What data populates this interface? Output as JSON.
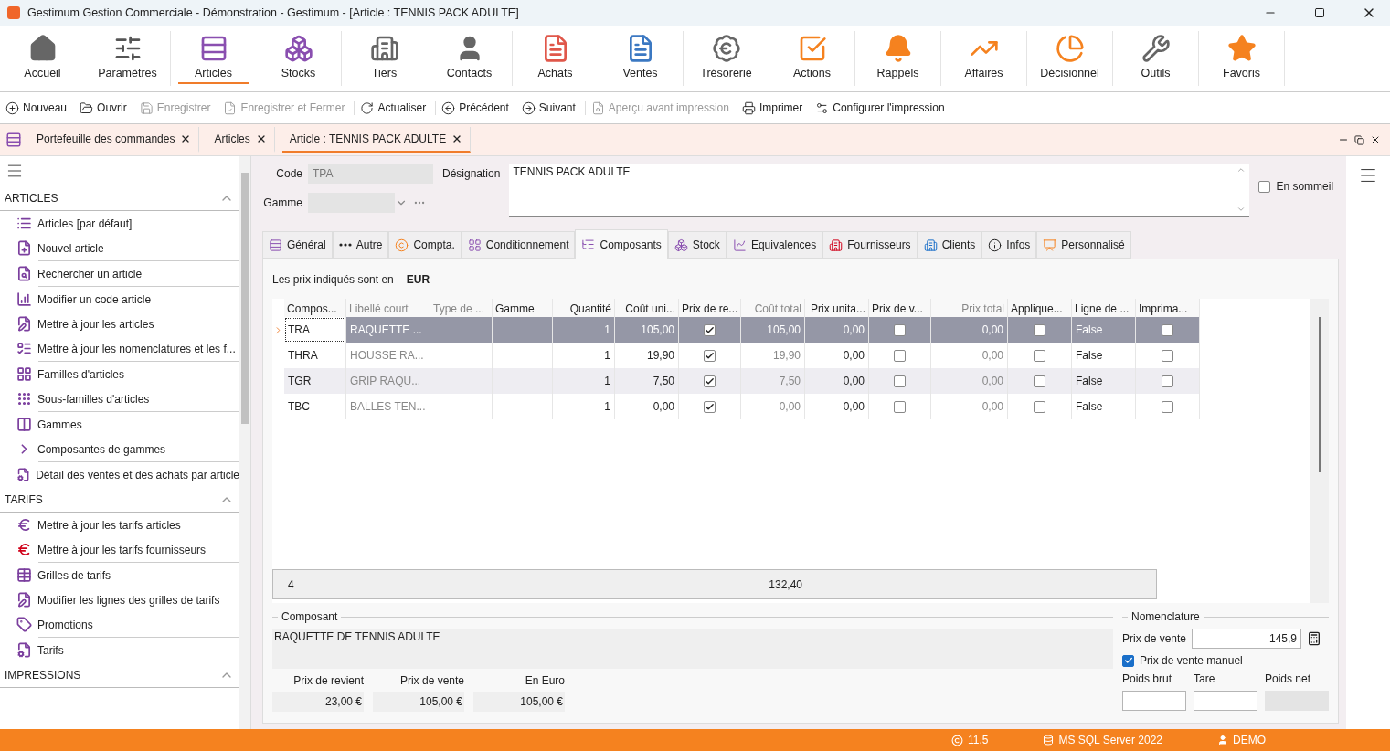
{
  "window": {
    "title": "Gestimum Gestion Commerciale - Démonstration - Gestimum - [Article : TENNIS PACK ADULTE]"
  },
  "ribbon": {
    "groups": [
      [
        {
          "label": "Accueil",
          "selected": false
        },
        {
          "label": "Paramètres",
          "selected": false
        }
      ],
      [
        {
          "label": "Articles",
          "selected": true
        },
        {
          "label": "Stocks",
          "selected": false
        }
      ],
      [
        {
          "label": "Tiers",
          "selected": false
        },
        {
          "label": "Contacts",
          "selected": false
        }
      ],
      [
        {
          "label": "Achats",
          "selected": false
        },
        {
          "label": "Ventes",
          "selected": false
        }
      ],
      [
        {
          "label": "Trésorerie",
          "selected": false
        }
      ],
      [
        {
          "label": "Actions",
          "selected": false
        }
      ],
      [
        {
          "label": "Rappels",
          "selected": false
        }
      ],
      [
        {
          "label": "Affaires",
          "selected": false
        }
      ],
      [
        {
          "label": "Décisionnel",
          "selected": false
        }
      ],
      [
        {
          "label": "Outils",
          "selected": false
        }
      ],
      [
        {
          "label": "Favoris",
          "selected": false
        }
      ]
    ]
  },
  "toolbar": {
    "groups": [
      [
        {
          "label": "Nouveau",
          "disabled": false
        },
        {
          "label": "Ouvrir",
          "disabled": false
        },
        {
          "label": "Enregistrer",
          "disabled": true
        },
        {
          "label": "Enregistrer et Fermer",
          "disabled": true
        }
      ],
      [
        {
          "label": "Actualiser",
          "disabled": false
        }
      ],
      [
        {
          "label": "Précédent",
          "disabled": false
        },
        {
          "label": "Suivant",
          "disabled": false
        }
      ],
      [
        {
          "label": "Aperçu avant impression",
          "disabled": true
        },
        {
          "label": "Imprimer",
          "disabled": false
        },
        {
          "label": "Configurer l'impression",
          "disabled": false
        }
      ]
    ]
  },
  "doc_tabs": [
    {
      "label": "Portefeuille des commandes",
      "selected": false
    },
    {
      "label": "Articles",
      "selected": false
    },
    {
      "label": "Article : TENNIS PACK ADULTE",
      "selected": true
    }
  ],
  "sidebar": {
    "sections": [
      {
        "title": "ARTICLES",
        "expanded": true,
        "groups": [
          [
            {
              "label": "Articles [par défaut]",
              "color": "#7b3f9e"
            },
            {
              "label": "Nouvel article",
              "color": "#7b3f9e"
            }
          ],
          [
            {
              "label": "Rechercher un article",
              "color": "#7b3f9e"
            }
          ],
          [
            {
              "label": "Modifier un code article",
              "color": "#7b3f9e"
            },
            {
              "label": "Mettre à jour les articles",
              "color": "#7b3f9e"
            },
            {
              "label": "Mettre à jour les nomenclatures et les f...",
              "color": "#7b3f9e"
            }
          ],
          [
            {
              "label": "Familles d'articles",
              "color": "#7b3f9e"
            },
            {
              "label": "Sous-familles d'articles",
              "color": "#7b3f9e"
            }
          ],
          [
            {
              "label": "Gammes",
              "color": "#7b3f9e"
            },
            {
              "label": "Composantes de gammes",
              "color": "#7b3f9e"
            }
          ],
          [
            {
              "label": "Détail des ventes et des achats par article",
              "color": "#7b3f9e"
            }
          ]
        ]
      },
      {
        "title": "TARIFS",
        "expanded": true,
        "groups": [
          [
            {
              "label": "Mettre à jour les tarifs articles",
              "color": "#7b3f9e"
            },
            {
              "label": "Mettre à jour les tarifs fournisseurs",
              "color": "#d0021b"
            }
          ],
          [
            {
              "label": "Grilles de tarifs",
              "color": "#7b3f9e"
            },
            {
              "label": "Modifier les lignes des grilles de tarifs",
              "color": "#7b3f9e"
            },
            {
              "label": "Promotions",
              "color": "#7b3f9e"
            }
          ],
          [
            {
              "label": "Tarifs",
              "color": "#7b3f9e"
            }
          ]
        ]
      },
      {
        "title": "IMPRESSIONS",
        "expanded": true
      }
    ]
  },
  "form": {
    "code": {
      "label": "Code",
      "value": "TPA"
    },
    "designation": {
      "label": "Désignation",
      "value": "TENNIS PACK ADULTE"
    },
    "gamme": {
      "label": "Gamme"
    },
    "sleeping": {
      "label": "En sommeil",
      "checked": false
    }
  },
  "form_tabs": [
    {
      "label": "Général",
      "selected": false
    },
    {
      "label": "Autre",
      "selected": false
    },
    {
      "label": "Compta.",
      "selected": false
    },
    {
      "label": "Conditionnement",
      "selected": false
    },
    {
      "label": "Composants",
      "selected": true
    },
    {
      "label": "Stock",
      "selected": false
    },
    {
      "label": "Equivalences",
      "selected": false
    },
    {
      "label": "Fournisseurs",
      "selected": false
    },
    {
      "label": "Clients",
      "selected": false
    },
    {
      "label": "Infos",
      "selected": false
    },
    {
      "label": "Personnalisé",
      "selected": false
    }
  ],
  "currency_note": {
    "label": "Les prix indiqués sont en",
    "value": "EUR"
  },
  "table": {
    "columns": [
      {
        "label": "Compos...",
        "kind": "text",
        "readonly": false
      },
      {
        "label": "Libellé court",
        "kind": "text",
        "readonly": true
      },
      {
        "label": "Type de ...",
        "kind": "text",
        "readonly": true
      },
      {
        "label": "Gamme",
        "kind": "text",
        "readonly": false
      },
      {
        "label": "Quantité",
        "kind": "number",
        "readonly": false
      },
      {
        "label": "Coût uni...",
        "kind": "number",
        "readonly": false
      },
      {
        "label": "Prix de re...",
        "kind": "check",
        "readonly": false
      },
      {
        "label": "Coût total",
        "kind": "number",
        "readonly": true
      },
      {
        "label": "Prix unita...",
        "kind": "number",
        "readonly": false
      },
      {
        "label": "Prix de v...",
        "kind": "check",
        "readonly": false
      },
      {
        "label": "Prix total",
        "kind": "number",
        "readonly": true
      },
      {
        "label": "Applique...",
        "kind": "check",
        "readonly": false
      },
      {
        "label": "Ligne de ...",
        "kind": "text",
        "readonly": false
      },
      {
        "label": "Imprima...",
        "kind": "check",
        "readonly": false
      }
    ],
    "rows": [
      {
        "selected": true,
        "cells": [
          "TRA",
          "RAQUETTE ...",
          null,
          null,
          "1",
          "105,00",
          {
            "checked": true
          },
          "105,00",
          "0,00",
          {
            "checked": false
          },
          "0,00",
          {
            "checked": false
          },
          "False",
          {
            "checked": false
          }
        ]
      },
      {
        "selected": false,
        "cells": [
          "THRA",
          "HOUSSE RA...",
          null,
          null,
          "1",
          "19,90",
          {
            "checked": true
          },
          "19,90",
          "0,00",
          {
            "checked": false
          },
          "0,00",
          {
            "checked": false
          },
          "False",
          {
            "checked": false
          }
        ]
      },
      {
        "selected": false,
        "cells": [
          "TGR",
          "GRIP RAQU...",
          null,
          null,
          "1",
          "7,50",
          {
            "checked": true
          },
          "7,50",
          "0,00",
          {
            "checked": false
          },
          "0,00",
          {
            "checked": false
          },
          "False",
          {
            "checked": false
          }
        ]
      },
      {
        "selected": false,
        "cells": [
          "TBC",
          "BALLES TEN...",
          null,
          null,
          "1",
          "0,00",
          {
            "checked": true
          },
          "0,00",
          "0,00",
          {
            "checked": false
          },
          "0,00",
          {
            "checked": false
          },
          "False",
          {
            "checked": false
          }
        ]
      }
    ],
    "footer": {
      "count": "4",
      "total": "132,40"
    }
  },
  "composant": {
    "title": "Composant",
    "description": "RAQUETTE DE TENNIS ADULTE",
    "prices": [
      {
        "label": "Prix de revient",
        "value": "23,00 €"
      },
      {
        "label": "Prix de vente",
        "value": "105,00 €"
      },
      {
        "label": "En Euro",
        "value": "105,00 €"
      }
    ]
  },
  "nomenclature": {
    "title": "Nomenclature",
    "price": {
      "label": "Prix de vente",
      "value": "145,9"
    },
    "manual": {
      "label": "Prix de vente manuel",
      "checked": true
    },
    "weights": [
      {
        "label": "Poids brut",
        "disabled": false
      },
      {
        "label": "Tare",
        "disabled": false
      },
      {
        "label": "Poids net",
        "disabled": true
      }
    ]
  },
  "status_bar": {
    "version": "11.5",
    "database": "MS SQL Server 2022",
    "user": "DEMO"
  }
}
